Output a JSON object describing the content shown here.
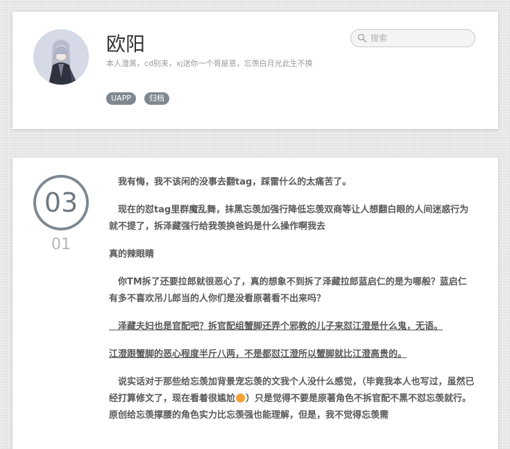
{
  "header": {
    "avatar_alt": "avatar",
    "title": "欧阳",
    "description": "本人澄黑，cd别来，xj送你一个哥屋恩，忘羡白月光此生不换",
    "search_placeholder": "搜索",
    "tags": [
      "UAPP",
      "归档"
    ]
  },
  "post": {
    "day": "03",
    "month": "01",
    "paragraphs": [
      "　我有悔，我不该闲的没事去翻tag，踩雷什么的太痛苦了。",
      "　现在的怼tag里群魔乱舞，抹黑忘羡加强行降低忘羡双商等让人想翻白眼的人间迷惑行为就不提了，拆泽藏强行给我羡换爸妈是什么操作啊我去",
      "真的辣眼睛",
      "　你TM拆了还要拉郎就很恶心了，真的想象不到拆了泽藏拉郎蓝启仁的是为哪般？蓝启仁有多不喜欢吊儿郎当的人你们是没看原著看不出来吗？",
      "　泽藏夫妇也是官配吧？拆官配组蟹脚还弄个邪教的儿子来怼江澄是什么鬼，无语。",
      "江澄跟蟹脚的恶心程度半斤八两，不是都怼江澄所以蟹脚就比江澄高贵的。",
      "　说实话对于那些给忘羡加背景宠忘羡的文我个人没什么感觉，（毕竟我本人也写过，虽然已经打算修文了，现在看着很尴尬",
      "）只是觉得不要是原著角色不拆官配不黑不怼忘羡就行。原创给忘羡撑腰的角色实力比忘羡强也能理解，但是，我不觉得忘羡需"
    ]
  },
  "colors": {
    "tag_bg": "#7f8890",
    "date_ring": "#7f8890"
  }
}
